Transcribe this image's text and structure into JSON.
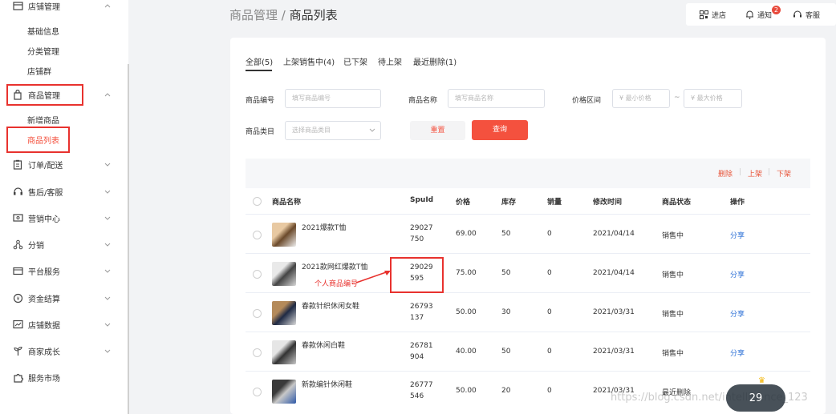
{
  "sidebar": {
    "groups": [
      {
        "label": "店铺管理",
        "icon": "store-icon"
      },
      {
        "label": "商品管理",
        "icon": "bag-icon"
      },
      {
        "label": "订单/配送",
        "icon": "clipboard-icon"
      },
      {
        "label": "售后/客服",
        "icon": "headset-icon"
      },
      {
        "label": "营销中心",
        "icon": "ticket-icon"
      },
      {
        "label": "分销",
        "icon": "share-nodes-icon"
      },
      {
        "label": "平台服务",
        "icon": "wallet-icon"
      },
      {
        "label": "资金结算",
        "icon": "coin-icon"
      },
      {
        "label": "店铺数据",
        "icon": "chart-icon"
      },
      {
        "label": "商家成长",
        "icon": "sprout-icon"
      },
      {
        "label": "服务市场",
        "icon": "puzzle-icon"
      }
    ],
    "store_sub": [
      "基础信息",
      "分类管理",
      "店铺群"
    ],
    "product_sub": [
      "新增商品",
      "商品列表"
    ]
  },
  "breadcrumb": {
    "parent": "商品管理",
    "sep": " / ",
    "current": "商品列表"
  },
  "topbar": {
    "store": "进店",
    "notice": "通知",
    "notice_count": "2",
    "service": "客服"
  },
  "tabs": [
    "全部(5)",
    "上架销售中(4)",
    "已下架",
    "待上架",
    "最近删除(1)"
  ],
  "filters": {
    "code_label": "商品编号",
    "code_placeholder": "填写商品编号",
    "name_label": "商品名称",
    "name_placeholder": "填写商品名称",
    "price_label": "价格区间",
    "price_min": "¥  最小价格",
    "price_sep": "~",
    "price_max": "¥  最大价格",
    "category_label": "商品类目",
    "category_placeholder": "选择商品类目",
    "reset": "重置",
    "query": "查询"
  },
  "bulk_actions": {
    "delete": "删除",
    "on": "上架",
    "off": "下架",
    "sep": "|"
  },
  "table": {
    "headers": [
      "商品名称",
      "SpuId",
      "价格",
      "库存",
      "销量",
      "修改时间",
      "商品状态",
      "操作"
    ],
    "rows": [
      {
        "name": "2021爆款T恤",
        "spu1": "29027",
        "spu2": "750",
        "price": "69.00",
        "stock": "50",
        "sales": "0",
        "time": "2021/04/14",
        "status": "销售中",
        "op": "分享"
      },
      {
        "name": "2021款网红爆款T恤",
        "spu1": "29029",
        "spu2": "595",
        "price": "75.00",
        "stock": "50",
        "sales": "0",
        "time": "2021/04/14",
        "status": "销售中",
        "op": "分享"
      },
      {
        "name": "春款针织休闲女鞋",
        "spu1": "26793",
        "spu2": "137",
        "price": "50.00",
        "stock": "30",
        "sales": "0",
        "time": "2021/03/31",
        "status": "销售中",
        "op": "分享"
      },
      {
        "name": "春款休闲白鞋",
        "spu1": "26781",
        "spu2": "904",
        "price": "40.00",
        "stock": "50",
        "sales": "0",
        "time": "2021/03/31",
        "status": "销售中",
        "op": "分享"
      },
      {
        "name": "新款编针休闲鞋",
        "spu1": "26777",
        "spu2": "546",
        "price": "50.00",
        "stock": "20",
        "sales": "0",
        "time": "2021/03/31",
        "status": "最近删除",
        "op": ""
      }
    ]
  },
  "annotation": "个人商品编号",
  "watermark": {
    "url": "https://blog.csdn.net/intelligence_123",
    "badge": "29"
  },
  "colors": {
    "accent": "#f4513e",
    "annotation": "#e8322e",
    "link": "#2b6fd6"
  }
}
